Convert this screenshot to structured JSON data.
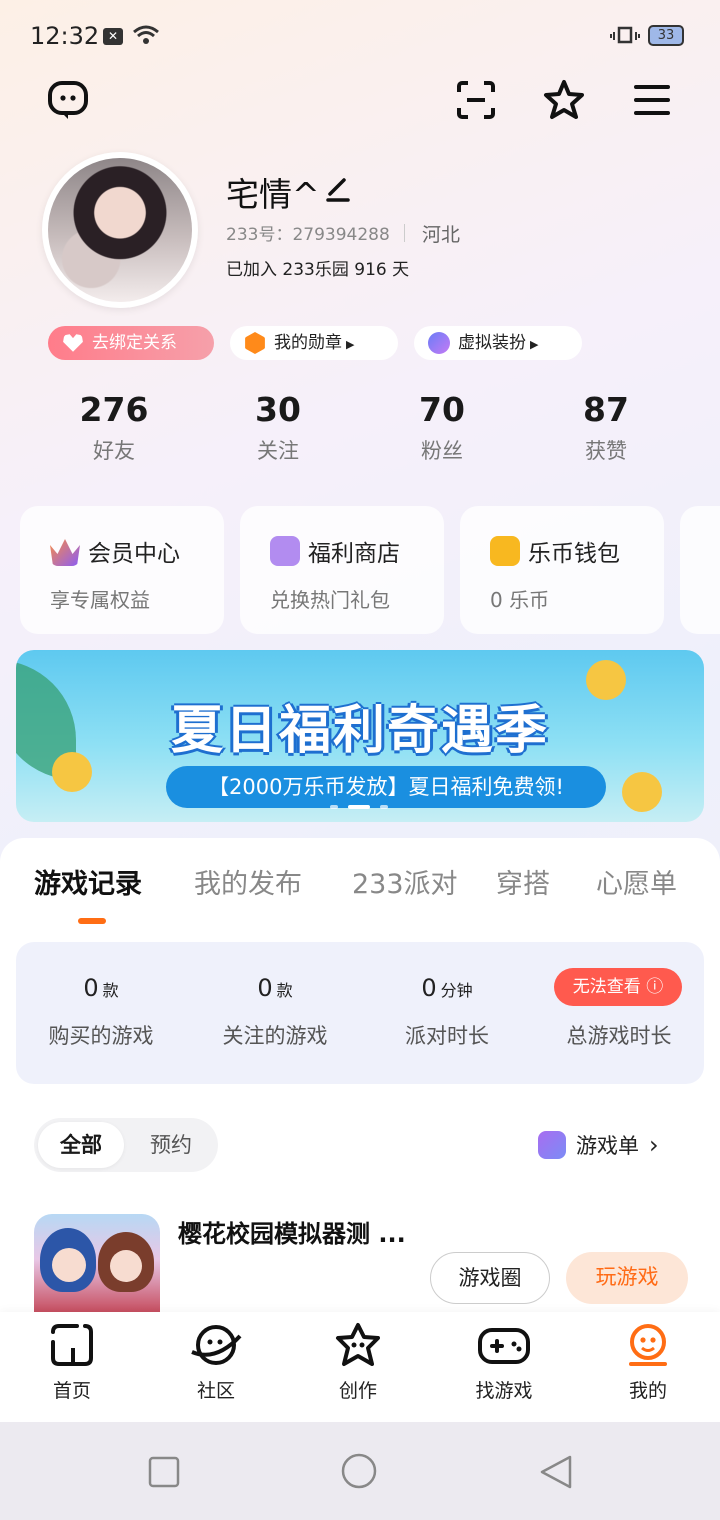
{
  "status_bar": {
    "time": "12:32",
    "battery": "33"
  },
  "header": {
    "icons": [
      "chat-bubble-icon",
      "scan-icon",
      "star-icon",
      "menu-icon"
    ]
  },
  "profile": {
    "name": "宅情^",
    "uid_label": "233号：",
    "uid": "279394288",
    "region": "河北",
    "joined": "已加入 233乐园 916 天"
  },
  "chips": [
    {
      "label": "去绑定关系",
      "icon": "heart-icon"
    },
    {
      "label": "我的勋章",
      "icon": "medal-icon"
    },
    {
      "label": "虚拟装扮",
      "icon": "avatar-costume-icon"
    }
  ],
  "stats": [
    {
      "value": "276",
      "label": "好友"
    },
    {
      "value": "30",
      "label": "关注"
    },
    {
      "value": "70",
      "label": "粉丝"
    },
    {
      "value": "87",
      "label": "获赞"
    }
  ],
  "cards": [
    {
      "title": "会员中心",
      "sub": "享专属权益",
      "color": "#8b5cf6"
    },
    {
      "title": "福利商店",
      "sub": "兑换热门礼包",
      "color": "#b28cf0"
    },
    {
      "title": "乐币钱包",
      "sub": "0 乐币",
      "color": "#f8b820"
    }
  ],
  "banner": {
    "title": "夏日福利奇遇季",
    "subtitle": "【2000万乐币发放】夏日福利免费领!"
  },
  "tabs": [
    "游戏记录",
    "我的发布",
    "233派对",
    "穿搭",
    "心愿单"
  ],
  "game_stats": [
    {
      "value": "0",
      "unit": "款",
      "label": "购买的游戏"
    },
    {
      "value": "0",
      "unit": "款",
      "label": "关注的游戏"
    },
    {
      "value": "0",
      "unit": "分钟",
      "label": "派对时长"
    },
    {
      "label": "总游戏时长",
      "badge": "无法查看"
    }
  ],
  "filter": {
    "all": "全部",
    "reserve": "预约",
    "list": "游戏单"
  },
  "game": {
    "name": "樱花校园模拟器测 ...",
    "circle_btn": "游戏圈",
    "play_btn": "玩游戏"
  },
  "bottom_nav": [
    {
      "label": "首页",
      "icon": "home-icon"
    },
    {
      "label": "社区",
      "icon": "planet-icon"
    },
    {
      "label": "创作",
      "icon": "star-create-icon"
    },
    {
      "label": "找游戏",
      "icon": "gamepad-icon"
    },
    {
      "label": "我的",
      "icon": "profile-face-icon"
    }
  ],
  "colors": {
    "accent": "#ff6d14",
    "warn": "#ff5a4e"
  }
}
